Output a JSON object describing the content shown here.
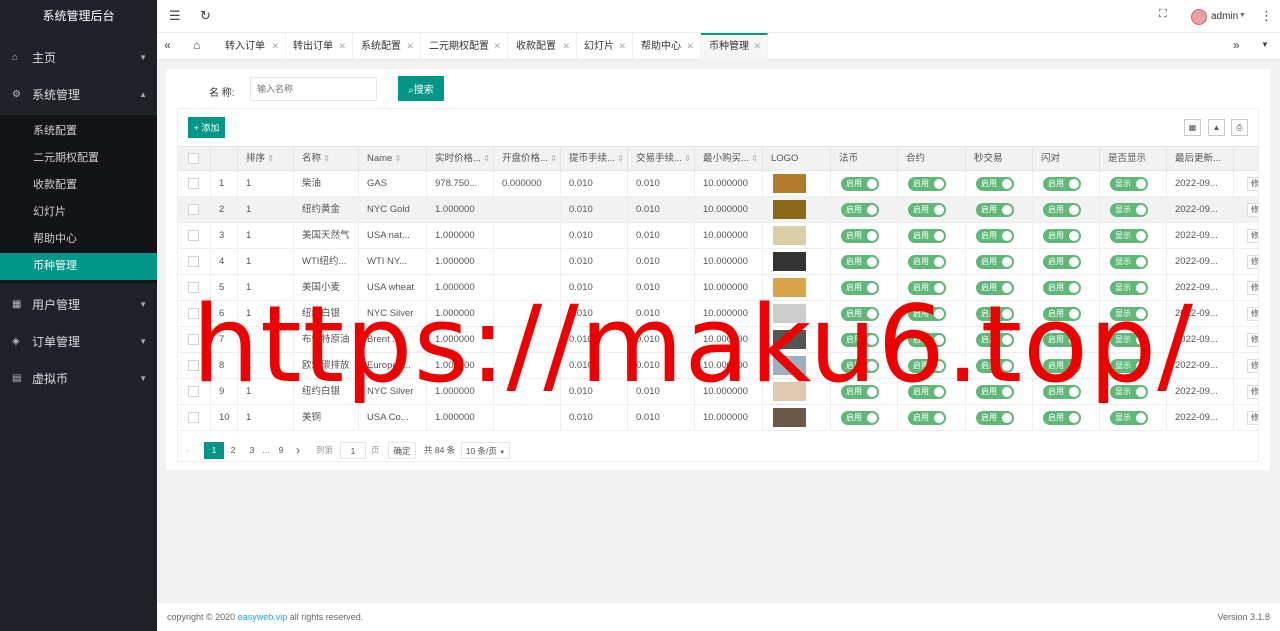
{
  "app": {
    "title": "系统管理后台"
  },
  "sidebar": {
    "items": [
      {
        "label": "主页",
        "icon": "home-icon"
      },
      {
        "label": "系统管理",
        "icon": "gear-icon",
        "expanded": true,
        "children": [
          "系统配置",
          "二元期权配置",
          "收款配置",
          "幻灯片",
          "帮助中心",
          "币种管理"
        ],
        "active_child": "币种管理"
      },
      {
        "label": "用户管理",
        "icon": "user-icon"
      },
      {
        "label": "订单管理",
        "icon": "order-icon"
      },
      {
        "label": "虚拟币",
        "icon": "coin-icon"
      }
    ]
  },
  "header": {
    "user": "admin"
  },
  "tabs": [
    "转入订单",
    "转出订单",
    "系统配置",
    "二元期权配置",
    "收款配置",
    "幻灯片",
    "帮助中心",
    "币种管理"
  ],
  "active_tab": "币种管理",
  "search": {
    "label": "名 称:",
    "placeholder": "输入名称",
    "button": "搜索"
  },
  "toolbar": {
    "add_label": "添加"
  },
  "table": {
    "columns": [
      "排序",
      "名称",
      "Name",
      "实时价格...",
      "开盘价格...",
      "提币手续...",
      "交易手续...",
      "最小购买...",
      "LOGO",
      "法币",
      "合约",
      "秒交易",
      "闪对",
      "是否显示",
      "最后更新..."
    ],
    "switch_on_label": "启用",
    "show_label": "显示",
    "edit_label": "修改",
    "rows": [
      {
        "idx": "1",
        "sort": "1",
        "name": "柴油",
        "en": "GAS",
        "price": "978.750...",
        "open": "0.000000",
        "fee_w": "0.010",
        "fee_t": "0.010",
        "min": "10.000000",
        "updated": "2022-09...",
        "logo": "#b07a2a"
      },
      {
        "idx": "2",
        "sort": "1",
        "name": "纽约黄金",
        "en": "NYC Gold",
        "price": "1.000000",
        "open": "",
        "fee_w": "0.010",
        "fee_t": "0.010",
        "min": "10.000000",
        "updated": "2022-09...",
        "logo": "#8a6a1a"
      },
      {
        "idx": "3",
        "sort": "1",
        "name": "美国天然气",
        "en": "USA nat...",
        "price": "1.000000",
        "open": "",
        "fee_w": "0.010",
        "fee_t": "0.010",
        "min": "10.000000",
        "updated": "2022-09...",
        "logo": "#d8cfa8"
      },
      {
        "idx": "4",
        "sort": "1",
        "name": "WTI纽约...",
        "en": "WTI NY...",
        "price": "1.000000",
        "open": "",
        "fee_w": "0.010",
        "fee_t": "0.010",
        "min": "10.000000",
        "updated": "2022-09...",
        "logo": "#333333"
      },
      {
        "idx": "5",
        "sort": "1",
        "name": "美国小麦",
        "en": "USA wheat",
        "price": "1.000000",
        "open": "",
        "fee_w": "0.010",
        "fee_t": "0.010",
        "min": "10.000000",
        "updated": "2022-09...",
        "logo": "#d9a44a"
      },
      {
        "idx": "6",
        "sort": "1",
        "name": "纽约白银",
        "en": "NYC Silver",
        "price": "1.000000",
        "open": "",
        "fee_w": "0.010",
        "fee_t": "0.010",
        "min": "10.000000",
        "updated": "2022-09...",
        "logo": "#cccccc"
      },
      {
        "idx": "7",
        "sort": "1",
        "name": "布伦特原油",
        "en": "Brent ...",
        "price": "1.000000",
        "open": "",
        "fee_w": "0.010",
        "fee_t": "0.010",
        "min": "10.000000",
        "updated": "2022-09...",
        "logo": "#555555"
      },
      {
        "idx": "8",
        "sort": "1",
        "name": "欧洲碳排放",
        "en": "Europea...",
        "price": "1.000000",
        "open": "",
        "fee_w": "0.010",
        "fee_t": "0.010",
        "min": "10.000000",
        "updated": "2022-09...",
        "logo": "#9ab0c0"
      },
      {
        "idx": "9",
        "sort": "1",
        "name": "纽约白银",
        "en": "NYC Silver",
        "price": "1.000000",
        "open": "",
        "fee_w": "0.010",
        "fee_t": "0.010",
        "min": "10.000000",
        "updated": "2022-09...",
        "logo": "#e0c8b0"
      },
      {
        "idx": "10",
        "sort": "1",
        "name": "美铜",
        "en": "USA Co...",
        "price": "1.000000",
        "open": "",
        "fee_w": "0.010",
        "fee_t": "0.010",
        "min": "10.000000",
        "updated": "2022-09...",
        "logo": "#6a5a4a"
      }
    ]
  },
  "pagination": {
    "pages": [
      "1",
      "2",
      "3",
      "...",
      "9"
    ],
    "current": "1",
    "goto_label": "到第",
    "goto_value": "1",
    "page_unit": "页",
    "confirm": "确定",
    "total": "共 84 条",
    "per_page": "10 条/页"
  },
  "watermark": "https://maku6.top/",
  "footer": {
    "copyright_prefix": "copyright © 2020 ",
    "link": "easyweb.vip",
    "copyright_suffix": " all rights reserved.",
    "version": "Version 3.1.8"
  },
  "colors": {
    "accent": "#009688",
    "sidebar": "#20222a",
    "switch": "#5FB878",
    "watermark": "#ee0000"
  }
}
